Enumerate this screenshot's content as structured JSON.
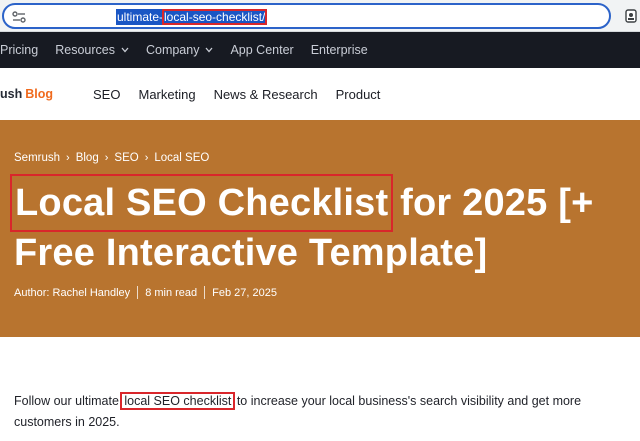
{
  "browser": {
    "url_prefix": "ultimate-",
    "url_highlight": "local-seo-checklist/"
  },
  "top_nav": {
    "items": [
      {
        "label": "Pricing",
        "dropdown": false
      },
      {
        "label": "Resources",
        "dropdown": true
      },
      {
        "label": "Company",
        "dropdown": true
      },
      {
        "label": "App Center",
        "dropdown": false
      },
      {
        "label": "Enterprise",
        "dropdown": false
      }
    ]
  },
  "blog_header": {
    "logo_brand": "ush",
    "logo_blog": "Blog",
    "nav": [
      "SEO",
      "Marketing",
      "News & Research",
      "Product"
    ]
  },
  "hero": {
    "background": "#b8742f",
    "breadcrumb": [
      "Semrush",
      "Blog",
      "SEO",
      "Local SEO"
    ],
    "title_highlight": "Local SEO Checklist",
    "title_rest": " for 2025 [+",
    "title_line2": "Free Interactive Template]",
    "author": "Author: Rachel Handley",
    "read_time": "8 min read",
    "date": "Feb 27, 2025"
  },
  "intro": {
    "before": "Follow our ultimate ",
    "highlight": "local SEO checklist",
    "after": " to increase your local business's search visibility and get more customers in 2025."
  },
  "colors": {
    "accent_orange": "#f06a1d",
    "annotation_red": "#d9262b",
    "nav_dark": "#171a22"
  }
}
